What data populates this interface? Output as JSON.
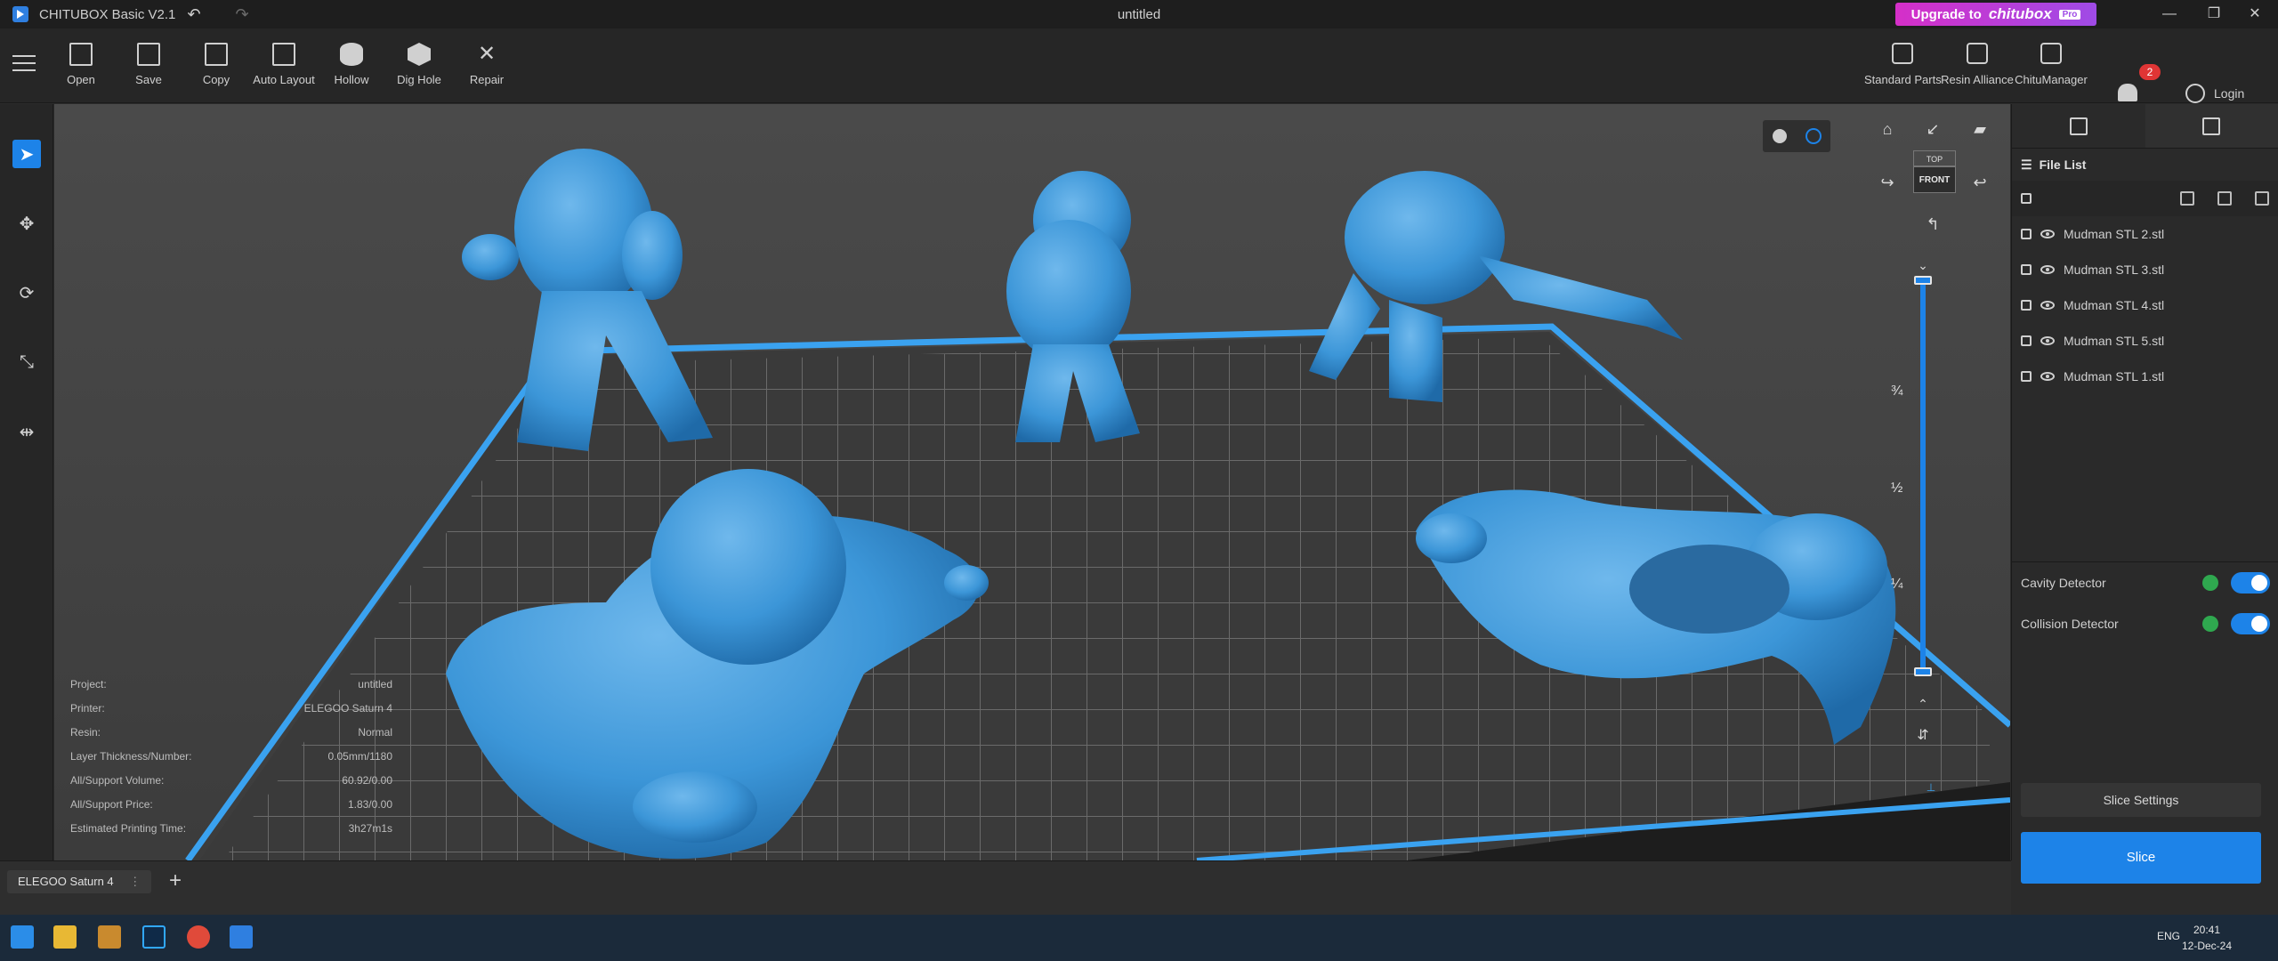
{
  "titlebar": {
    "app_name": "CHITUBOX Basic V2.1",
    "doc_title": "untitled",
    "upgrade_prefix": "Upgrade to",
    "upgrade_brand": "chitubox",
    "upgrade_tag": "Pro"
  },
  "toolbar": {
    "tools": [
      "Open",
      "Save",
      "Copy",
      "Auto Layout",
      "Hollow",
      "Dig Hole",
      "Repair"
    ],
    "right_tools": [
      "Standard Parts",
      "Resin Alliance",
      "ChituManager"
    ],
    "notifications": "2",
    "login": "Login"
  },
  "viewport": {
    "viewcube_top": "TOP",
    "viewcube_front": "FRONT",
    "layer_ticks": [
      "¾",
      "½",
      "¼"
    ],
    "info": [
      {
        "label": "Project:",
        "value": "untitled"
      },
      {
        "label": "Printer:",
        "value": "ELEGOO Saturn 4"
      },
      {
        "label": "Resin:",
        "value": "Normal"
      },
      {
        "label": "Layer Thickness/Number:",
        "value": "0.05mm/1180"
      },
      {
        "label": "All/Support Volume:",
        "value": "60.92/0.00"
      },
      {
        "label": "All/Support Price:",
        "value": "1.83/0.00"
      },
      {
        "label": "Estimated Printing Time:",
        "value": "3h27m1s"
      }
    ]
  },
  "panel": {
    "file_list_title": "File List",
    "files": [
      "Mudman STL 2.stl",
      "Mudman STL 3.stl",
      "Mudman STL 4.stl",
      "Mudman STL 5.stl",
      "Mudman STL 1.stl"
    ],
    "cavity_detector": "Cavity Detector",
    "collision_detector": "Collision Detector",
    "slice_settings": "Slice Settings",
    "slice": "Slice"
  },
  "bottom": {
    "printer_tab": "ELEGOO Saturn 4",
    "add_tab": "+"
  },
  "taskbar": {
    "lang": "ENG",
    "time": "20:41",
    "date": "12-Dec-24"
  },
  "colors": {
    "accent": "#1d83e8",
    "model": "#3c96d8",
    "bed_edge": "#3aa2f0"
  }
}
